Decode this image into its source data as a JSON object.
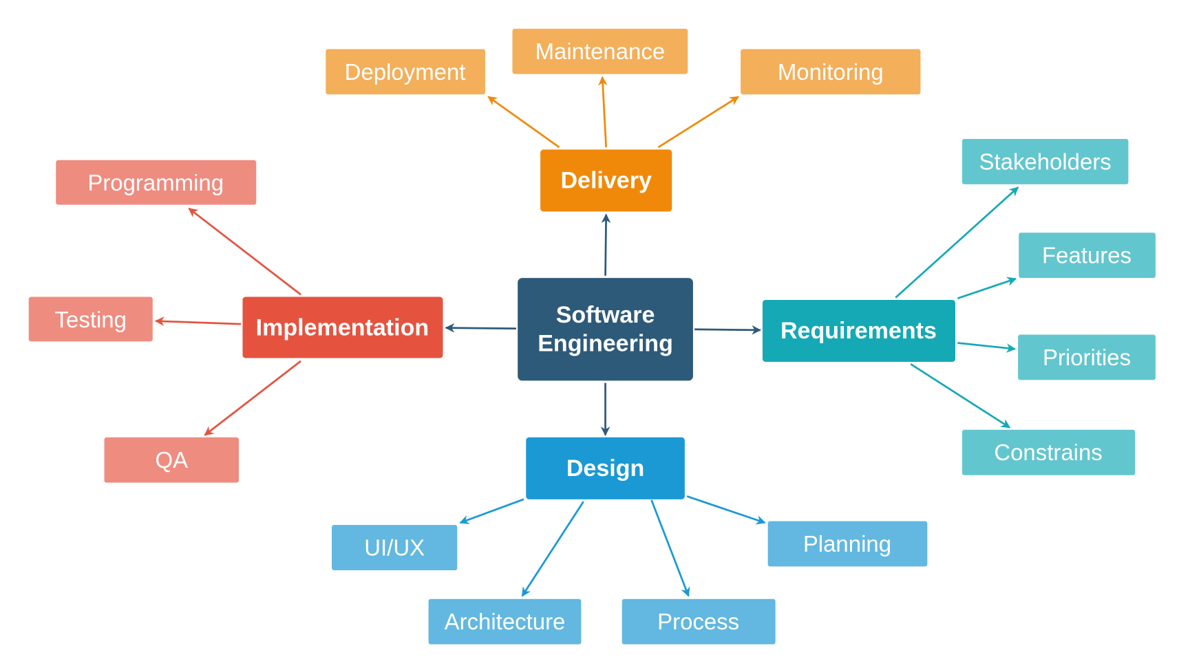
{
  "diagram": {
    "center": {
      "label_line1": "Software",
      "label_line2": "Engineering",
      "color": "#2e5a7a"
    },
    "delivery": {
      "label": "Delivery",
      "color": "#f0890a",
      "child_color": "#f4af5a",
      "children": [
        "Deployment",
        "Maintenance",
        "Monitoring"
      ]
    },
    "implementation": {
      "label": "Implementation",
      "color": "#e5533f",
      "child_color": "#ef8c80",
      "children": [
        "Programming",
        "Testing",
        "QA"
      ]
    },
    "requirements": {
      "label": "Requirements",
      "color": "#14a9b5",
      "child_color": "#62c6ce",
      "children": [
        "Stakeholders",
        "Features",
        "Priorities",
        "Constrains"
      ]
    },
    "design": {
      "label": "Design",
      "color": "#1a99d4",
      "child_color": "#62b8e0",
      "children": [
        "UI/UX",
        "Architecture",
        "Process",
        "Planning"
      ]
    }
  }
}
